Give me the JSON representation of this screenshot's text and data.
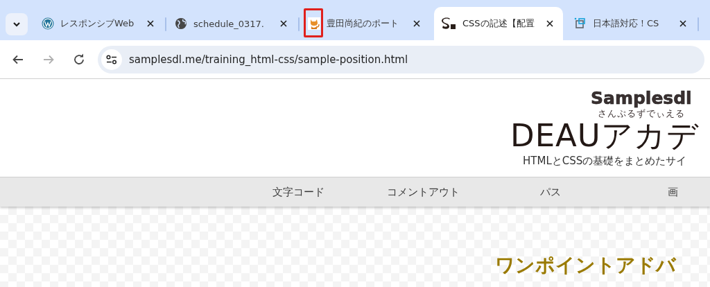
{
  "tab_strip": {
    "tabs": [
      {
        "title": "レスポンシブWeb",
        "kind": "wordpress",
        "selected": false,
        "circled": false
      },
      {
        "title": "schedule_0317.",
        "kind": "globe",
        "selected": false,
        "circled": false
      },
      {
        "title": "豊田尚紀のポート",
        "kind": "cat",
        "selected": false,
        "circled": true
      },
      {
        "title": "CSSの記述【配置",
        "kind": "s-logo",
        "selected": true,
        "circled": false
      },
      {
        "title": "日本語対応！CS",
        "kind": "image",
        "selected": false,
        "circled": false
      }
    ]
  },
  "toolbar": {
    "back_disabled": false,
    "forward_disabled": true,
    "address": "samplesdl.me/training_html-css/sample-position.html"
  },
  "page": {
    "logo": {
      "name": "Samplesdl",
      "reading": "さんぷるずでぃえる"
    },
    "site_title": "DEAUアカデ",
    "tagline": "HTMLとCSSの基礎をまとめたサイ",
    "nav": [
      "文字コード",
      "コメントアウト",
      "パス",
      "画"
    ],
    "heading": "ワンポイントアドバ"
  }
}
